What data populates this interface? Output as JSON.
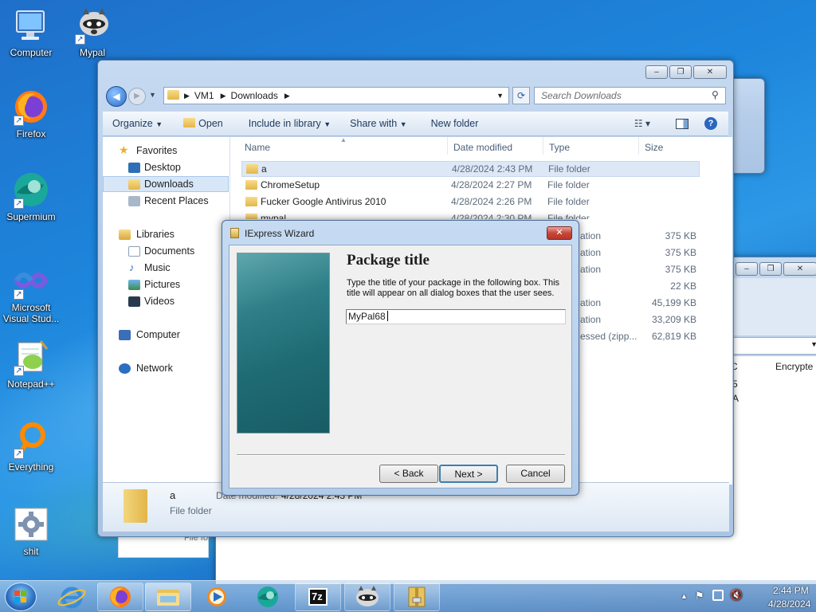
{
  "desktop": {
    "icons": [
      {
        "label": "Computer",
        "icon": "computer-icon"
      },
      {
        "label": "Mypal",
        "icon": "raccoon-icon"
      },
      {
        "label": "Firefox",
        "icon": "firefox-icon"
      },
      {
        "label": "Supermium",
        "icon": "supermium-icon"
      },
      {
        "label": "Microsoft Visual Stud...",
        "icon": "visual-studio-icon"
      },
      {
        "label": "Notepad++",
        "icon": "notepadpp-icon"
      },
      {
        "label": "Everything",
        "icon": "everything-icon"
      },
      {
        "label": "shit",
        "icon": "settings-gear-icon"
      }
    ]
  },
  "explorer": {
    "breadcrumb": [
      "VM1",
      "Downloads"
    ],
    "search_placeholder": "Search Downloads",
    "toolbar": {
      "organize": "Organize",
      "open": "Open",
      "include_in_library": "Include in library",
      "share_with": "Share with",
      "new_folder": "New folder"
    },
    "nav": {
      "favorites": "Favorites",
      "desktop": "Desktop",
      "downloads": "Downloads",
      "recent_places": "Recent Places",
      "libraries": "Libraries",
      "documents": "Documents",
      "music": "Music",
      "pictures": "Pictures",
      "videos": "Videos",
      "computer": "Computer",
      "network": "Network"
    },
    "columns": {
      "name": "Name",
      "date_modified": "Date modified",
      "type": "Type",
      "size": "Size"
    },
    "rows": [
      {
        "name": "a",
        "date": "4/28/2024 2:43 PM",
        "type": "File folder",
        "size": ""
      },
      {
        "name": "ChromeSetup",
        "date": "4/28/2024 2:27 PM",
        "type": "File folder",
        "size": ""
      },
      {
        "name": "Fucker Google Antivirus 2010",
        "date": "4/28/2024 2:26 PM",
        "type": "File folder",
        "size": ""
      },
      {
        "name": "mypal",
        "date": "4/28/2024 2:30 PM",
        "type": "File folder",
        "size": ""
      }
    ],
    "partial_rows": [
      {
        "type": "ation",
        "size": "375 KB"
      },
      {
        "type": "ation",
        "size": "375 KB"
      },
      {
        "type": "ation",
        "size": "375 KB"
      },
      {
        "type": "",
        "size": "22 KB"
      },
      {
        "type": "ation",
        "size": "45,199 KB"
      },
      {
        "type": "ation",
        "size": "33,209 KB"
      },
      {
        "type": "essed (zipp...",
        "size": "62,819 KB"
      }
    ],
    "details": {
      "name": "a",
      "date_label": "Date modified:",
      "date_value": "4/28/2024 2:43 PM",
      "type": "File folder"
    }
  },
  "background_window": {
    "column_c": "C",
    "column_encrypte": "Encrypte",
    "cell1": "5",
    "cell2": "A",
    "file_label": "File fo"
  },
  "dialog": {
    "title": "IExpress Wizard",
    "heading": "Package title",
    "description": "Type the title of your package in the following  box.  This title will appear on all dialog boxes that the user sees.",
    "input_value": "MyPal68",
    "back_button": "< Back",
    "next_button": "Next >",
    "cancel_button": "Cancel"
  },
  "taskbar": {
    "apps": [
      "start-orb-icon",
      "internet-explorer-icon",
      "firefox-icon",
      "file-explorer-icon",
      "media-player-icon",
      "supermium-icon",
      "7zip-icon",
      "raccoon-icon",
      "archive-icon"
    ],
    "seven_zip_label": "7z",
    "time": "2:44 PM",
    "date": "4/28/2024"
  },
  "colors": {
    "desktop_blue": "#1d86dc",
    "close_red": "#c7463a",
    "dialog_panel_teal": "#1f6b74",
    "selected_row": "#dde8f6"
  }
}
